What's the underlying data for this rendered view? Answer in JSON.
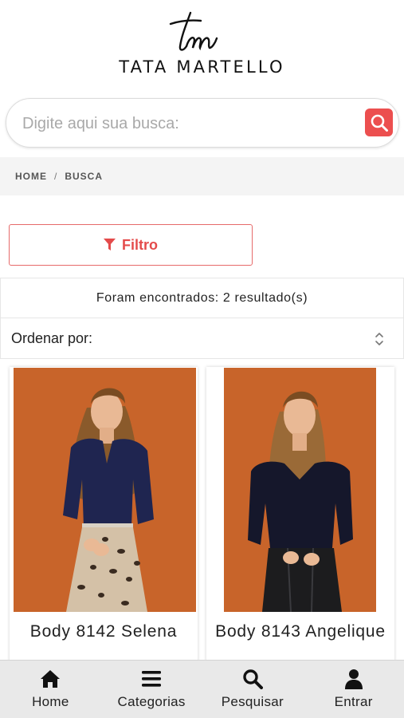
{
  "brand": {
    "name": "TATA MARTELLO"
  },
  "search": {
    "placeholder": "Digite aqui sua busca:"
  },
  "breadcrumb": {
    "home": "HOME",
    "separator": "/",
    "current": "BUSCA"
  },
  "filter": {
    "label": "Filtro"
  },
  "results": {
    "text": "Foram encontrados: 2 resultado(s)"
  },
  "sort": {
    "label": "Ordenar por:"
  },
  "products": [
    {
      "name": "Body 8142 Selena",
      "image_icon": "product-photo"
    },
    {
      "name": "Body 8143 Angelique",
      "image_icon": "product-photo"
    }
  ],
  "bottom_nav": [
    {
      "label": "Home",
      "icon": "home-icon"
    },
    {
      "label": "Categorias",
      "icon": "menu-icon"
    },
    {
      "label": "Pesquisar",
      "icon": "search-icon"
    },
    {
      "label": "Entrar",
      "icon": "user-icon"
    }
  ],
  "colors": {
    "accent": "#ec4f4f",
    "background_photo": "#c8642a"
  }
}
